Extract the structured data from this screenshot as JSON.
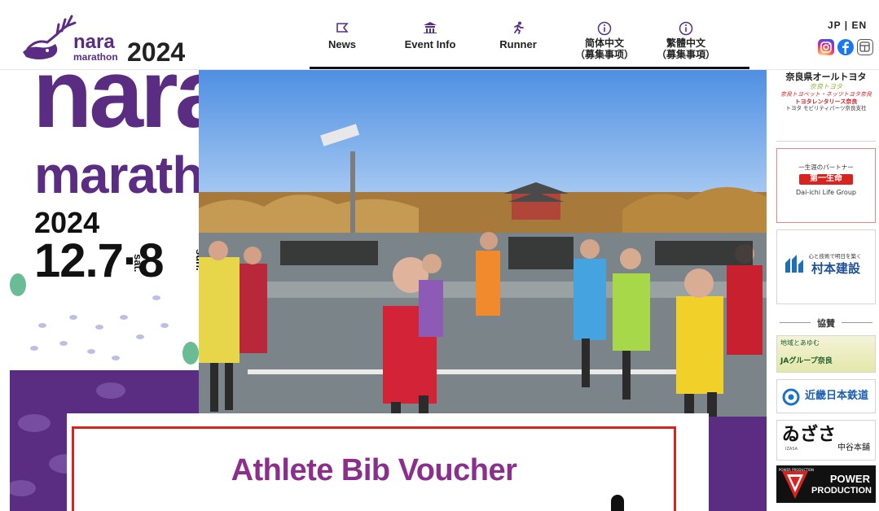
{
  "header": {
    "logo": {
      "nara": "nara",
      "marathon": "marathon",
      "year": "2024"
    },
    "nav": [
      {
        "icon": "flag-icon",
        "label": "News"
      },
      {
        "icon": "temple-icon",
        "label": "Event Info"
      },
      {
        "icon": "runner-icon",
        "label": "Runner"
      },
      {
        "icon": "info-icon",
        "label": "简体中文",
        "label2": "（募集事项）"
      },
      {
        "icon": "info-icon",
        "label": "繁體中文",
        "label2": "（募集事項）"
      }
    ],
    "lang": "JP | EN",
    "social": [
      "instagram-icon",
      "facebook-icon",
      "line-icon"
    ]
  },
  "hero": {
    "big_nara": "nara",
    "big_marathon": "marathon",
    "year": "2024",
    "date": "12.7·8",
    "sat": "sat.",
    "sun": "sun."
  },
  "sponsors": {
    "toyota": {
      "line1": "奈良県オールトヨタ",
      "line2": "奈良トヨタ",
      "line3": "奈良トヨペット・ネッツトヨタ奈良",
      "line4": "トヨタレンタリース奈良",
      "line5": "トヨタ モビリティパーツ奈良支社"
    },
    "daiichi": {
      "line1": "一生涯のパートナー",
      "badge": "第一生命",
      "line2": "Dai-ichi Life Group"
    },
    "murakami": {
      "small": "心と技術で明日を築く",
      "name": "村本建設"
    },
    "kyosan_label": "協賛",
    "ja": {
      "line1": "地域とあゆむ",
      "line2": "JAグループ奈良"
    },
    "kintetsu": "近畿日本鉄道",
    "izasa": {
      "line1": "ゐざさ",
      "line2": "中谷本舗",
      "small": "IZASA"
    },
    "power": {
      "line1": "POWER",
      "line2": "PRODUCTION",
      "small": "POWER PRODUCTION"
    }
  },
  "voucher": {
    "title": "Athlete Bib Voucher"
  },
  "colors": {
    "brand_purple": "#5a2d82",
    "voucher_red": "#d8231f",
    "voucher_text": "#8a2f8c"
  }
}
